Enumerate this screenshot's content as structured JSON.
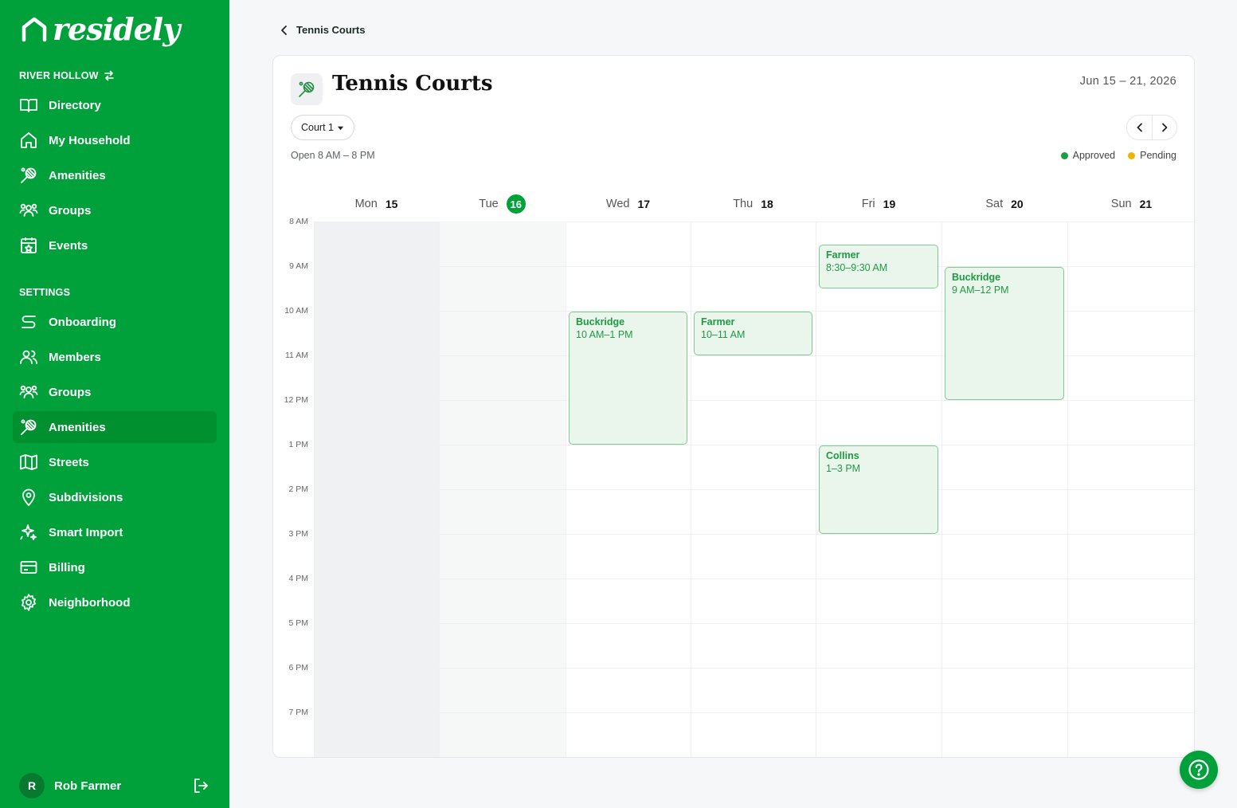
{
  "brand": {
    "name": "residely",
    "color": "#00a13b"
  },
  "community": {
    "name": "RIVER HOLLOW"
  },
  "nav": [
    {
      "label": "Directory",
      "icon": "book-icon"
    },
    {
      "label": "My Household",
      "icon": "home-icon"
    },
    {
      "label": "Amenities",
      "icon": "tennis-racket-icon"
    },
    {
      "label": "Groups",
      "icon": "users-group-icon"
    },
    {
      "label": "Events",
      "icon": "calendar-star-icon"
    }
  ],
  "settings": {
    "label": "SETTINGS",
    "items": [
      {
        "label": "Onboarding",
        "icon": "route-icon"
      },
      {
        "label": "Members",
        "icon": "users-icon"
      },
      {
        "label": "Groups",
        "icon": "users-group-icon"
      },
      {
        "label": "Amenities",
        "icon": "tennis-racket-icon",
        "active": true
      },
      {
        "label": "Streets",
        "icon": "map-icon"
      },
      {
        "label": "Subdivisions",
        "icon": "map-pin-icon"
      },
      {
        "label": "Smart Import",
        "icon": "sparkles-icon"
      },
      {
        "label": "Billing",
        "icon": "credit-card-icon"
      },
      {
        "label": "Neighborhood",
        "icon": "gear-icon"
      }
    ]
  },
  "user": {
    "initial": "R",
    "name": "Rob Farmer"
  },
  "page": {
    "back_label": "Tennis Courts",
    "title": "Tennis Courts",
    "date_range": "Jun 15 – 21, 2026",
    "court": "Court 1",
    "hours": "Open 8 AM – 8 PM"
  },
  "legend": [
    {
      "label": "Approved",
      "color": "#1e9e44"
    },
    {
      "label": "Pending",
      "color": "#f0b400"
    }
  ],
  "days": [
    {
      "name": "Mon",
      "num": "15"
    },
    {
      "name": "Tue",
      "num": "16",
      "today": true
    },
    {
      "name": "Wed",
      "num": "17"
    },
    {
      "name": "Thu",
      "num": "18"
    },
    {
      "name": "Fri",
      "num": "19"
    },
    {
      "name": "Sat",
      "num": "20"
    },
    {
      "name": "Sun",
      "num": "21"
    }
  ],
  "hour_labels": [
    "8 AM",
    "9 AM",
    "10 AM",
    "11 AM",
    "12 PM",
    "1 PM",
    "2 PM",
    "3 PM",
    "4 PM",
    "5 PM",
    "6 PM",
    "7 PM"
  ],
  "events": [
    {
      "day": 2,
      "start": 10,
      "end": 13,
      "name": "Buckridge",
      "time": "10 AM–1 PM",
      "status": "Approved"
    },
    {
      "day": 3,
      "start": 10,
      "end": 11,
      "name": "Farmer",
      "time": "10–11 AM",
      "status": "Approved"
    },
    {
      "day": 4,
      "start": 8.5,
      "end": 9.5,
      "name": "Farmer",
      "time": "8:30–9:30 AM",
      "status": "Approved"
    },
    {
      "day": 4,
      "start": 13,
      "end": 15,
      "name": "Collins",
      "time": "1–3 PM",
      "status": "Approved"
    },
    {
      "day": 5,
      "start": 9,
      "end": 12,
      "name": "Buckridge",
      "time": "9 AM–12 PM",
      "status": "Approved"
    }
  ]
}
